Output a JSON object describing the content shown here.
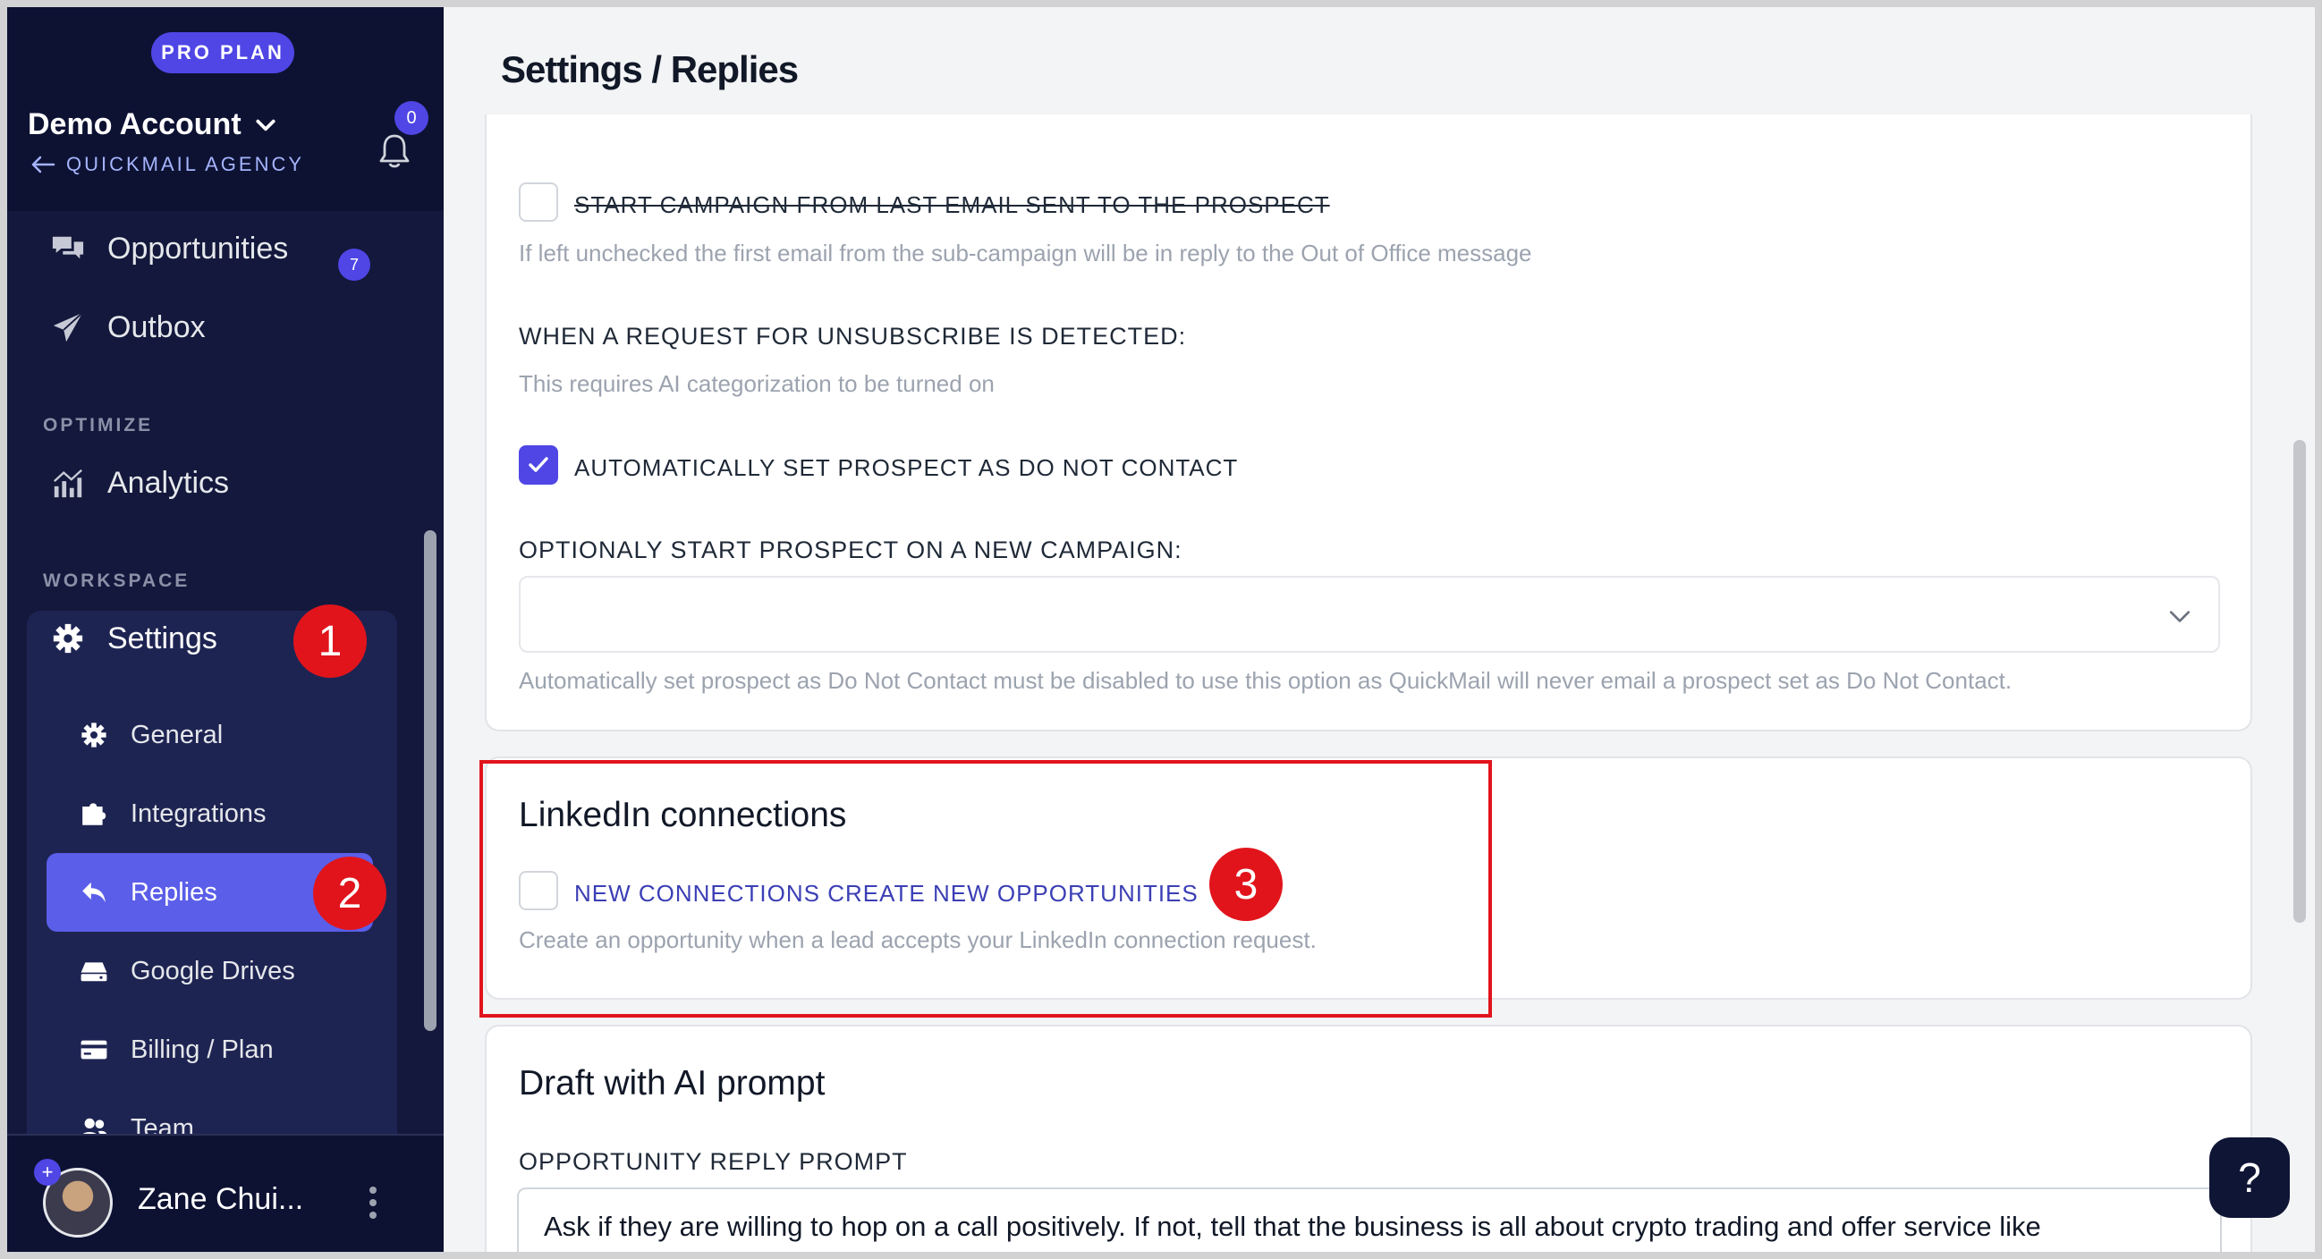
{
  "sidebar": {
    "plan_badge": "PRO PLAN",
    "account_name": "Demo Account",
    "agency_link": "QUICKMAIL AGENCY",
    "notification_count": "0",
    "nav": {
      "opportunities": {
        "label": "Opportunities",
        "count": "7"
      },
      "outbox": {
        "label": "Outbox"
      }
    },
    "sections": {
      "optimize": "OPTIMIZE",
      "workspace": "WORKSPACE"
    },
    "analytics": {
      "label": "Analytics"
    },
    "settings": {
      "label": "Settings",
      "items": [
        {
          "label": "General",
          "icon": "gear-icon"
        },
        {
          "label": "Integrations",
          "icon": "puzzle-icon"
        },
        {
          "label": "Replies",
          "icon": "reply-icon",
          "active": true
        },
        {
          "label": "Google Drives",
          "icon": "drive-icon"
        },
        {
          "label": "Billing / Plan",
          "icon": "credit-card-icon"
        },
        {
          "label": "Team",
          "icon": "team-icon"
        }
      ]
    },
    "user": {
      "name": "Zane Chui..."
    }
  },
  "main": {
    "title": "Settings / Replies",
    "out_of_office": {
      "start_from_last": {
        "label": "START CAMPAIGN FROM LAST EMAIL SENT TO THE PROSPECT",
        "checked": false
      },
      "start_from_last_help": "If left unchecked the first email from the sub-campaign will be in reply to the Out of Office message",
      "unsubscribe_heading": "WHEN A REQUEST FOR UNSUBSCRIBE IS DETECTED:",
      "unsubscribe_help": "This requires AI categorization to be turned on",
      "auto_dnc": {
        "label": "AUTOMATICALLY SET PROSPECT AS DO NOT CONTACT",
        "checked": true
      },
      "new_campaign_heading": "OPTIONALY START PROSPECT ON A NEW CAMPAIGN:",
      "new_campaign_value": "",
      "new_campaign_help": "Automatically set prospect as Do Not Contact must be disabled to use this option as QuickMail will never email a prospect set as Do Not Contact."
    },
    "linkedin": {
      "title": "LinkedIn connections",
      "option": {
        "label": "NEW CONNECTIONS CREATE NEW OPPORTUNITIES",
        "checked": false
      },
      "help": "Create an opportunity when a lead accepts your LinkedIn connection request."
    },
    "ai": {
      "title": "Draft with AI prompt",
      "prompt_label": "OPPORTUNITY REPLY PROMPT",
      "prompt_value": "Ask if they are willing to hop on a call positively. If not, tell that the business is all about crypto trading and offer service like"
    }
  },
  "annotations": {
    "step1": "1",
    "step2": "2",
    "step3": "3"
  },
  "help_button": "?",
  "colors": {
    "accent": "#4f46e5",
    "sidebar_bg": "#13183c",
    "annotation": "#e1141c"
  }
}
